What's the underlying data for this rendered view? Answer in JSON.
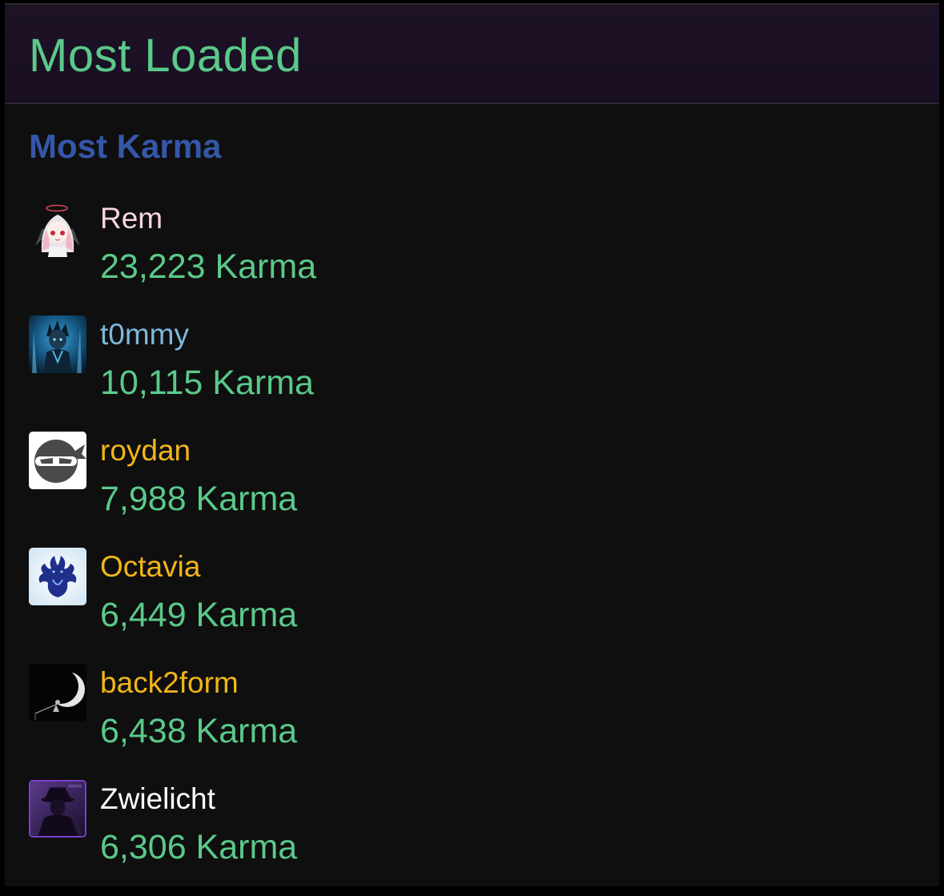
{
  "panel": {
    "title": "Most Loaded",
    "section_title": "Most Karma"
  },
  "colors": {
    "header_text": "#5ac98a",
    "section_title": "#3457a8",
    "karma": "#5ac98a",
    "name_pink": "#f6d6dc",
    "name_blue": "#7fb7dc",
    "name_gold": "#f2b519",
    "name_white": "#ffffff"
  },
  "users": [
    {
      "name": "Rem",
      "karma": "23,223 Karma",
      "name_color": "#f6d6dc",
      "avatar_icon": "anime-girl-avatar-icon"
    },
    {
      "name": "t0mmy",
      "karma": "10,115 Karma",
      "name_color": "#7fb7dc",
      "avatar_icon": "anime-warrior-avatar-icon"
    },
    {
      "name": "roydan",
      "karma": "7,988 Karma",
      "name_color": "#f2b519",
      "avatar_icon": "ninja-head-avatar-icon"
    },
    {
      "name": "Octavia",
      "karma": "6,449 Karma",
      "name_color": "#f2b519",
      "avatar_icon": "hydra-avatar-icon"
    },
    {
      "name": "back2form",
      "karma": "6,438 Karma",
      "name_color": "#f2b519",
      "avatar_icon": "moon-fisherman-avatar-icon"
    },
    {
      "name": "Zwielicht",
      "karma": "6,306 Karma",
      "name_color": "#ffffff",
      "avatar_icon": "shadow-figure-avatar-icon"
    }
  ]
}
